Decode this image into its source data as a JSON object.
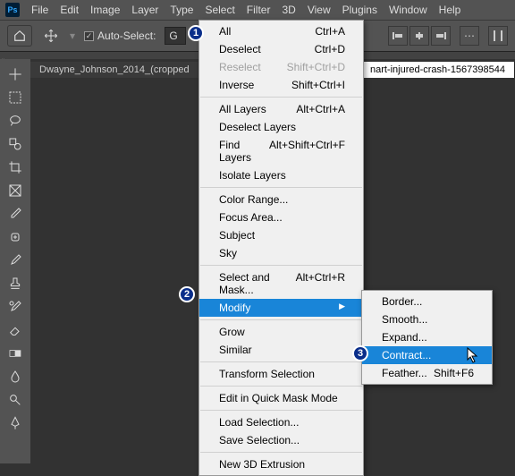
{
  "menubar": {
    "items": [
      "File",
      "Edit",
      "Image",
      "Layer",
      "Type",
      "Select",
      "Filter",
      "3D",
      "View",
      "Plugins",
      "Window",
      "Help"
    ]
  },
  "optbar": {
    "auto_select": "Auto-Select:",
    "group_stub": "G"
  },
  "tabs": {
    "left": "Dwayne_Johnson_2014_(cropped",
    "right": "nart-injured-crash-1567398544"
  },
  "select_menu": {
    "all": {
      "label": "All",
      "sc": "Ctrl+A"
    },
    "deselect": {
      "label": "Deselect",
      "sc": "Ctrl+D"
    },
    "reselect": {
      "label": "Reselect",
      "sc": "Shift+Ctrl+D"
    },
    "inverse": {
      "label": "Inverse",
      "sc": "Shift+Ctrl+I"
    },
    "alllayers": {
      "label": "All Layers",
      "sc": "Alt+Ctrl+A"
    },
    "desellayers": {
      "label": "Deselect Layers"
    },
    "findlayers": {
      "label": "Find Layers",
      "sc": "Alt+Shift+Ctrl+F"
    },
    "isolate": {
      "label": "Isolate Layers"
    },
    "colorrange": {
      "label": "Color Range..."
    },
    "focus": {
      "label": "Focus Area..."
    },
    "subject": {
      "label": "Subject"
    },
    "sky": {
      "label": "Sky"
    },
    "mask": {
      "label": "Select and Mask...",
      "sc": "Alt+Ctrl+R"
    },
    "modify": {
      "label": "Modify"
    },
    "grow": {
      "label": "Grow"
    },
    "similar": {
      "label": "Similar"
    },
    "transform": {
      "label": "Transform Selection"
    },
    "quickmask": {
      "label": "Edit in Quick Mask Mode"
    },
    "load": {
      "label": "Load Selection..."
    },
    "save": {
      "label": "Save Selection..."
    },
    "new3d": {
      "label": "New 3D Extrusion"
    }
  },
  "modify_menu": {
    "border": {
      "label": "Border..."
    },
    "smooth": {
      "label": "Smooth..."
    },
    "expand": {
      "label": "Expand..."
    },
    "contract": {
      "label": "Contract..."
    },
    "feather": {
      "label": "Feather...",
      "sc": "Shift+F6"
    }
  },
  "badges": {
    "one": "1",
    "two": "2",
    "three": "3"
  }
}
